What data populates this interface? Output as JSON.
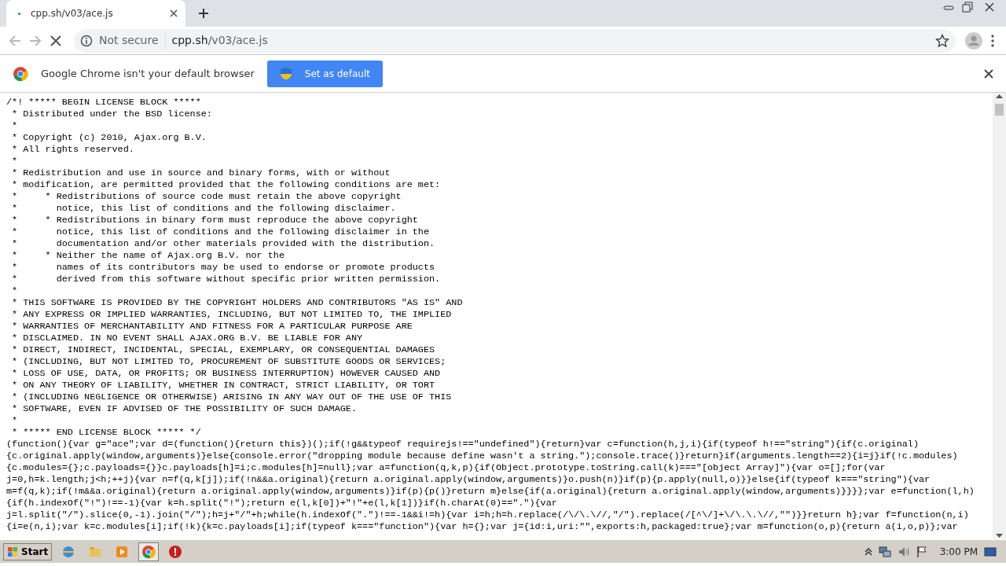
{
  "tab": {
    "title": "cpp.sh/v03/ace.js",
    "selected": true
  },
  "toolbar": {
    "loading": true,
    "security": "Not secure",
    "url_host": "cpp.sh",
    "url_path": "/v03/ace.js"
  },
  "infobar": {
    "message": "Google Chrome isn't your default browser",
    "button": "Set as default"
  },
  "code_lines": [
    "/*! ***** BEGIN LICENSE BLOCK *****",
    " * Distributed under the BSD license:",
    " *",
    " * Copyright (c) 2010, Ajax.org B.V.",
    " * All rights reserved.",
    " *",
    " * Redistribution and use in source and binary forms, with or without",
    " * modification, are permitted provided that the following conditions are met:",
    " *     * Redistributions of source code must retain the above copyright",
    " *       notice, this list of conditions and the following disclaimer.",
    " *     * Redistributions in binary form must reproduce the above copyright",
    " *       notice, this list of conditions and the following disclaimer in the",
    " *       documentation and/or other materials provided with the distribution.",
    " *     * Neither the name of Ajax.org B.V. nor the",
    " *       names of its contributors may be used to endorse or promote products",
    " *       derived from this software without specific prior written permission.",
    " *",
    " * THIS SOFTWARE IS PROVIDED BY THE COPYRIGHT HOLDERS AND CONTRIBUTORS \"AS IS\" AND",
    " * ANY EXPRESS OR IMPLIED WARRANTIES, INCLUDING, BUT NOT LIMITED TO, THE IMPLIED",
    " * WARRANTIES OF MERCHANTABILITY AND FITNESS FOR A PARTICULAR PURPOSE ARE",
    " * DISCLAIMED. IN NO EVENT SHALL AJAX.ORG B.V. BE LIABLE FOR ANY",
    " * DIRECT, INDIRECT, INCIDENTAL, SPECIAL, EXEMPLARY, OR CONSEQUENTIAL DAMAGES",
    " * (INCLUDING, BUT NOT LIMITED TO, PROCUREMENT OF SUBSTITUTE GOODS OR SERVICES;",
    " * LOSS OF USE, DATA, OR PROFITS; OR BUSINESS INTERRUPTION) HOWEVER CAUSED AND",
    " * ON ANY THEORY OF LIABILITY, WHETHER IN CONTRACT, STRICT LIABILITY, OR TORT",
    " * (INCLUDING NEGLIGENCE OR OTHERWISE) ARISING IN ANY WAY OUT OF THE USE OF THIS",
    " * SOFTWARE, EVEN IF ADVISED OF THE POSSIBILITY OF SUCH DAMAGE.",
    " *",
    " * ***** END LICENSE BLOCK ***** */",
    "(function(){var g=\"ace\";var d=(function(){return this})();if(!g&&typeof requirejs!==\"undefined\"){return}var c=function(h,j,i){if(typeof h!==\"string\"){if(c.original)",
    "{c.original.apply(window,arguments)}else{console.error(\"dropping module because define wasn't a string.\");console.trace()}return}if(arguments.length==2){i=j}if(!c.modules)",
    "{c.modules={};c.payloads={}}c.payloads[h]=i;c.modules[h]=null};var a=function(q,k,p){if(Object.prototype.toString.call(k)===\"[object Array]\"){var o=[];for(var",
    "j=0,h=k.length;j<h;++j){var n=f(q,k[j]);if(!n&&a.original){return a.original.apply(window,arguments)}o.push(n)}if(p){p.apply(null,o)}}else{if(typeof k===\"string\"){var",
    "m=f(q,k);if(!m&&a.original){return a.original.apply(window,arguments)}if(p){p()}return m}else{if(a.original){return a.original.apply(window,arguments)}}}};var e=function(l,h)",
    "{if(h.indexOf(\"!\")!==-1){var k=h.split(\"!\");return e(l,k[0])+\"!\"+e(l,k[1])}if(h.charAt(0)==\".\"){var",
    "j=l.split(\"/\").slice(0,-1).join(\"/\");h=j+\"/\"+h;while(h.indexOf(\".\")!==-1&&i!=h){var i=h;h=h.replace(/\\/\\.\\//,\"/\").replace(/[^\\/]+\\/\\.\\.\\//,\"\")}}return h};var f=function(n,i)",
    "{i=e(n,i);var k=c.modules[i];if(!k){k=c.payloads[i];if(typeof k===\"function\"){var h={};var j={id:i,uri:\"\",exports:h,packaged:true};var m=function(o,p){return a(i,o,p)};var"
  ],
  "taskbar": {
    "start": "Start",
    "clock": "3:00 PM"
  }
}
